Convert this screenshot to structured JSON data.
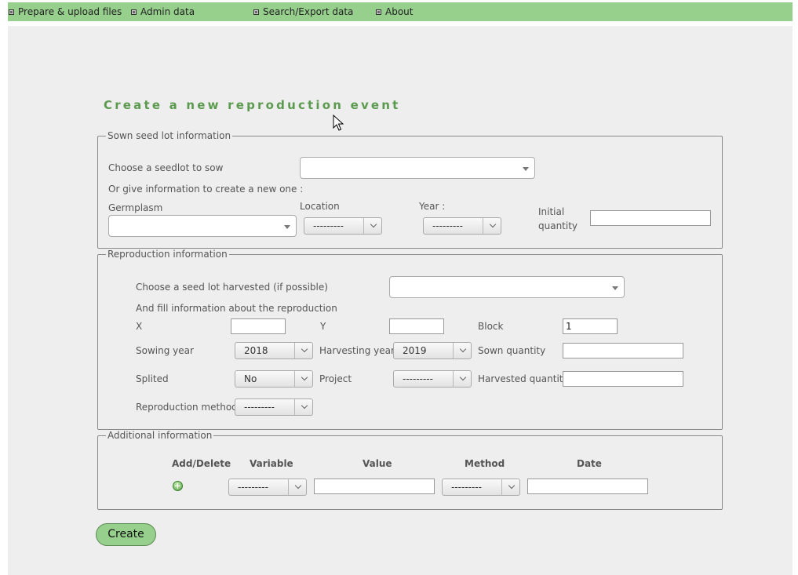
{
  "menu": {
    "items": [
      {
        "label": "Prepare & upload files"
      },
      {
        "label": "Admin data"
      },
      {
        "label": "Search/Export data"
      },
      {
        "label": "About"
      }
    ]
  },
  "page": {
    "title": "Create a new reproduction event"
  },
  "sown": {
    "legend": "Sown seed lot information",
    "choose_label": "Choose a seedlot to sow",
    "choose_value": "",
    "or_text": "Or give information to create a new one :",
    "germplasm_label": "Germplasm",
    "germplasm_value": "",
    "location_label": "Location",
    "location_value": "---------",
    "year_label": "Year :",
    "year_value": "---------",
    "initial_quantity_label_line1": "Initial",
    "initial_quantity_label_line2": "quantity",
    "initial_quantity_value": ""
  },
  "repro": {
    "legend": "Reproduction information",
    "harvested_label": "Choose a seed lot harvested (if possible)",
    "harvested_value": "",
    "fill_text": "And fill information about the reproduction",
    "x_label": "X",
    "x_value": "",
    "y_label": "Y",
    "y_value": "",
    "block_label": "Block",
    "block_value": "1",
    "sowing_year_label": "Sowing year",
    "sowing_year_value": "2018",
    "harvesting_year_label": "Harvesting year",
    "harvesting_year_value": "2019",
    "sown_quantity_label": "Sown quantity",
    "sown_quantity_value": "",
    "splited_label": "Splited",
    "splited_value": "No",
    "project_label": "Project",
    "project_value": "---------",
    "harvested_quantity_label": "Harvested quantity",
    "harvested_quantity_value": "",
    "method_label": "Reproduction method",
    "method_value": "---------"
  },
  "additional": {
    "legend": "Additional information",
    "headers": {
      "add_delete": "Add/Delete",
      "variable": "Variable",
      "value": "Value",
      "method": "Method",
      "date": "Date"
    },
    "row": {
      "variable": "---------",
      "value": "",
      "method": "---------",
      "date": ""
    }
  },
  "actions": {
    "create_label": "Create"
  },
  "colors": {
    "menubar": "#97cf8d",
    "title": "#5b9a4f",
    "button": "#97cf8d",
    "panel": "#eeeeee"
  },
  "icons": {
    "add": "add-circle-icon",
    "menu_bullet": "square-bullet-icon"
  }
}
